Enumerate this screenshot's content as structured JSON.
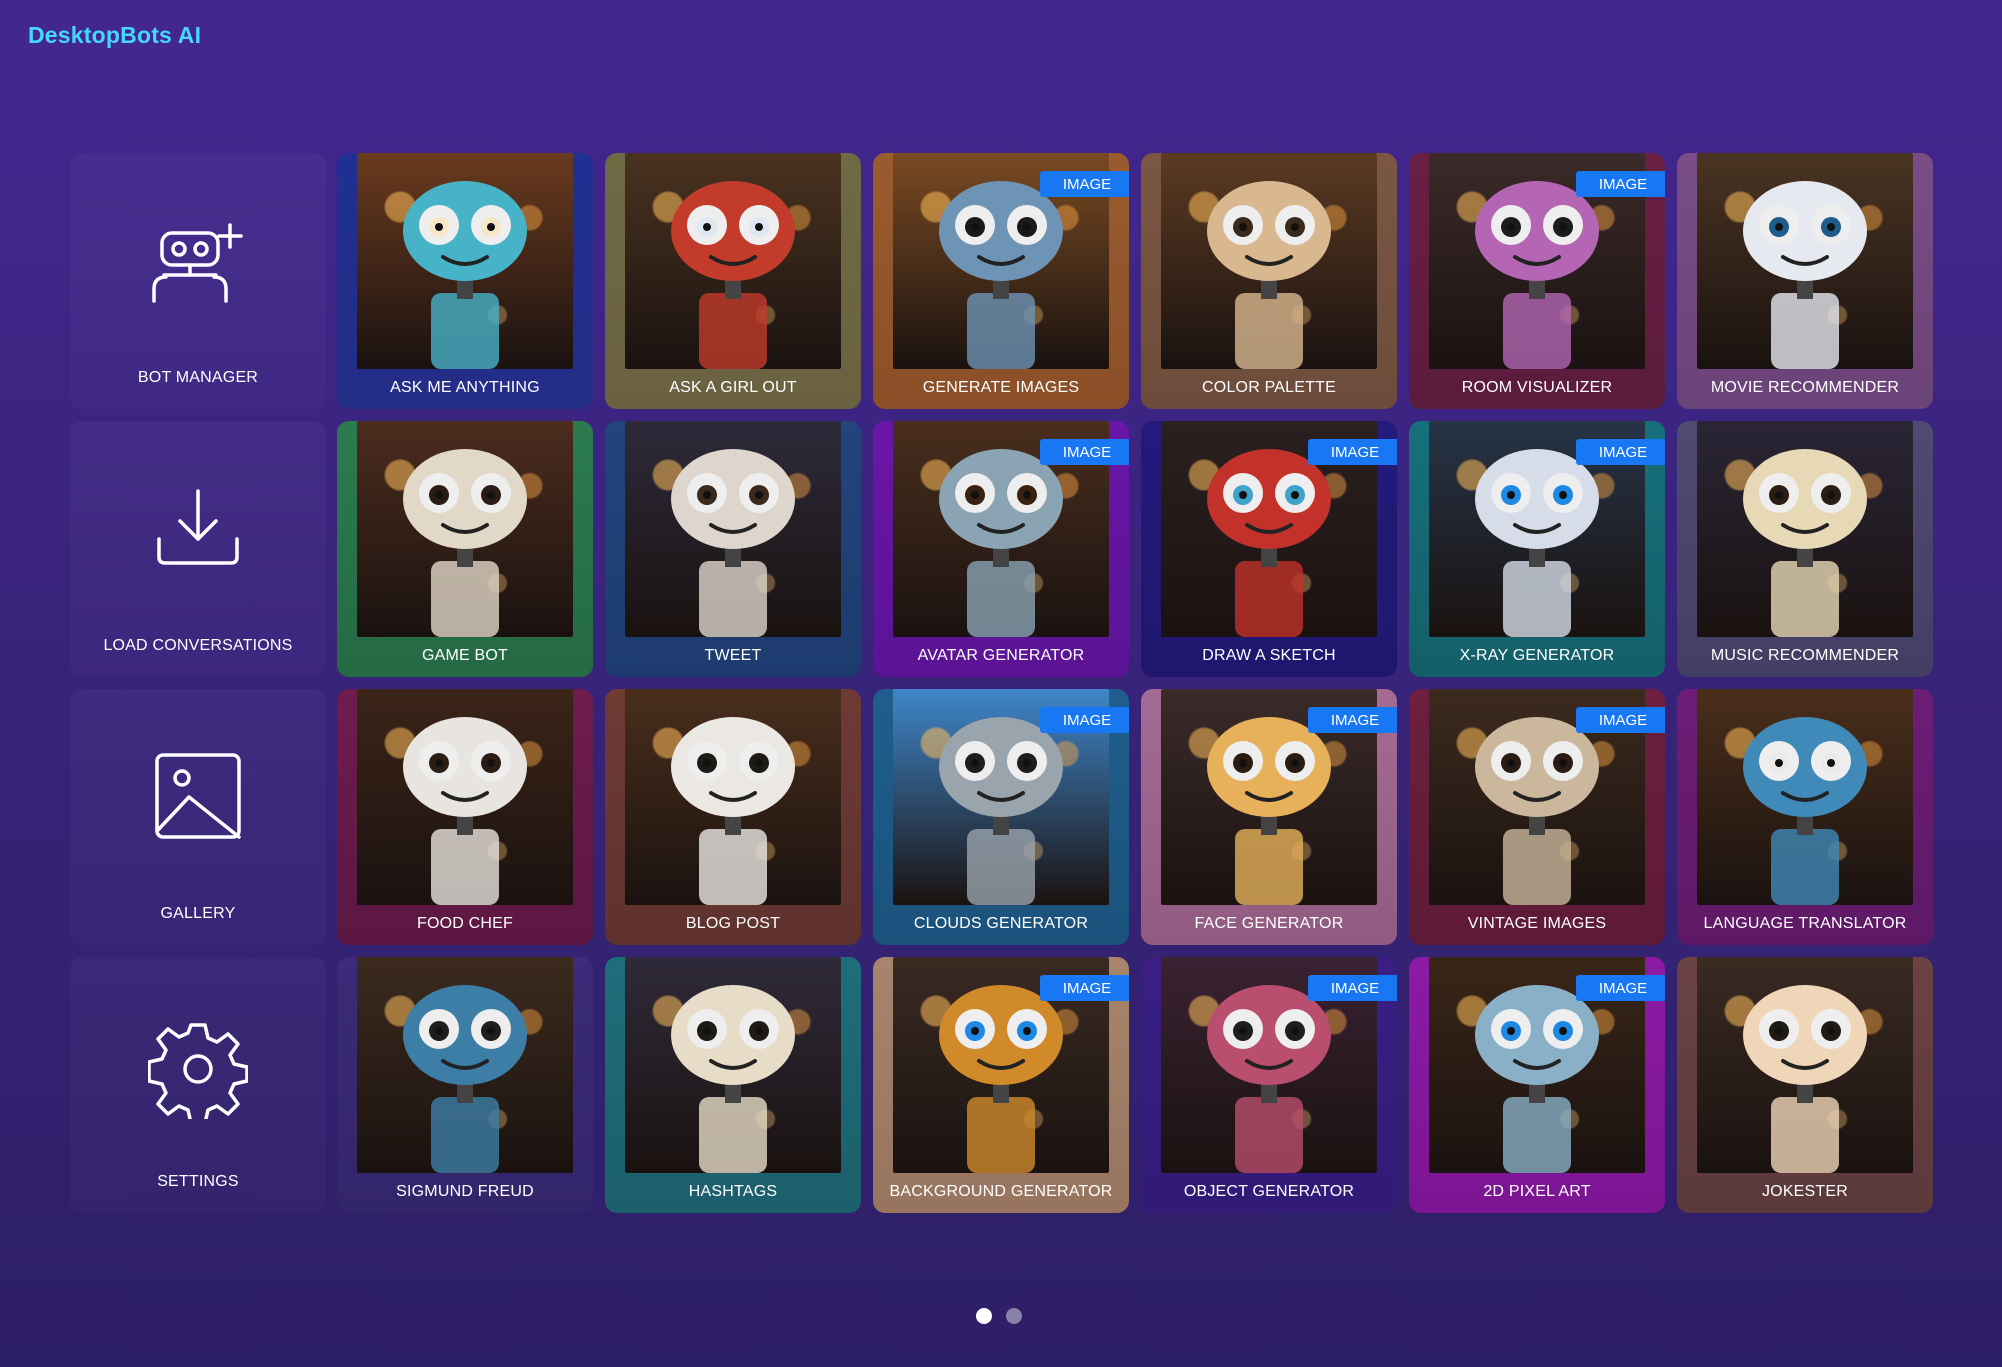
{
  "app": {
    "title": "DesktopBots AI"
  },
  "sidebar": [
    {
      "id": "bot-manager",
      "label": "BOT MANAGER",
      "icon": "robot-add-icon"
    },
    {
      "id": "load-conversations",
      "label": "LOAD CONVERSATIONS",
      "icon": "download-icon"
    },
    {
      "id": "gallery",
      "label": "GALLERY",
      "icon": "image-icon"
    },
    {
      "id": "settings",
      "label": "SETTINGS",
      "icon": "gear-icon"
    }
  ],
  "badge_text": "IMAGE",
  "bots": [
    {
      "label": "ASK ME ANYTHING",
      "image": false,
      "frame": [
        "#1f2f92",
        "#242d86"
      ],
      "face": "#47b3c9",
      "eye": "#f8e6c9",
      "bg": "#6a3a1e"
    },
    {
      "label": "ASK A GIRL OUT",
      "image": false,
      "frame": [
        "#6e6a44",
        "#6a6140"
      ],
      "face": "#c23b2b",
      "eye": "#dfe7f0",
      "bg": "#4a3320"
    },
    {
      "label": "GENERATE IMAGES",
      "image": true,
      "frame": [
        "#9a5b2f",
        "#8b4f27"
      ],
      "face": "#6d94b5",
      "eye": "#1a1a1a",
      "bg": "#7a4a22"
    },
    {
      "label": "COLOR PALETTE",
      "image": false,
      "frame": [
        "#7b5743",
        "#6d4c3b"
      ],
      "face": "#d9b88f",
      "eye": "#3a2a1c",
      "bg": "#5c3a22"
    },
    {
      "label": "ROOM VISUALIZER",
      "image": true,
      "frame": [
        "#6a1f45",
        "#5a1b3c"
      ],
      "face": "#b466b5",
      "eye": "#1c1c1c",
      "bg": "#3b2a2a"
    },
    {
      "label": "MOVIE RECOMMENDER",
      "image": false,
      "frame": [
        "#7a4d86",
        "#6a4378"
      ],
      "face": "#e6e9ef",
      "eye": "#1e5c8c",
      "bg": "#4a3422"
    },
    {
      "label": "GAME BOT",
      "image": false,
      "frame": [
        "#2c7b4f",
        "#246a44"
      ],
      "face": "#e2d8c7",
      "eye": "#2a1c14",
      "bg": "#4c2c1d"
    },
    {
      "label": "TWEET",
      "image": false,
      "frame": [
        "#22457e",
        "#1d3b6e"
      ],
      "face": "#ded6cc",
      "eye": "#3a2a1e",
      "bg": "#2d2a3a"
    },
    {
      "label": "AVATAR GENERATOR",
      "image": true,
      "frame": [
        "#6a16a8",
        "#5b1394"
      ],
      "face": "#8aa4b4",
      "eye": "#3a2212",
      "bg": "#4a2e1e"
    },
    {
      "label": "DRAW A SKETCH",
      "image": true,
      "frame": [
        "#231a7c",
        "#1f176e"
      ],
      "face": "#c2322a",
      "eye": "#3fa2c9",
      "bg": "#2a2020"
    },
    {
      "label": "X-RAY GENERATOR",
      "image": true,
      "frame": [
        "#16707b",
        "#135f69"
      ],
      "face": "#d6dde8",
      "eye": "#1e88e5",
      "bg": "#263447"
    },
    {
      "label": "MUSIC RECOMMENDER",
      "image": false,
      "frame": [
        "#4f4a72",
        "#433f64"
      ],
      "face": "#e8d9b6",
      "eye": "#2a1e14",
      "bg": "#2a2536"
    },
    {
      "label": "FOOD CHEF",
      "image": false,
      "frame": [
        "#6e1c4e",
        "#5c1742"
      ],
      "face": "#e8e4df",
      "eye": "#2c1e14",
      "bg": "#3c2418"
    },
    {
      "label": "BLOG POST",
      "image": false,
      "frame": [
        "#6e3b35",
        "#5f322d"
      ],
      "face": "#ebe8e3",
      "eye": "#1e1a16",
      "bg": "#4a2e1c"
    },
    {
      "label": "CLOUDS GENERATOR",
      "image": true,
      "frame": [
        "#1f5e8d",
        "#1b527c"
      ],
      "face": "#9aa4ad",
      "eye": "#1e1e1e",
      "bg": "#3f86c9"
    },
    {
      "label": "FACE GENERATOR",
      "image": true,
      "frame": [
        "#a46b93",
        "#915b81"
      ],
      "face": "#e6b15a",
      "eye": "#2a1c10",
      "bg": "#3a2b2a"
    },
    {
      "label": "VINTAGE IMAGES",
      "image": true,
      "frame": [
        "#6d1f3f",
        "#5d1a36"
      ],
      "face": "#cbb89c",
      "eye": "#2a1c14",
      "bg": "#3c2a1e"
    },
    {
      "label": "LANGUAGE TRANSLATOR",
      "image": false,
      "frame": [
        "#6d1d76",
        "#5e1966"
      ],
      "face": "#3f8ab8",
      "eye": "#eaeaea",
      "bg": "#4a2e1a"
    },
    {
      "label": "SIGMUND FREUD",
      "image": false,
      "frame": [
        "#3b2b78",
        "#33256a"
      ],
      "face": "#3d7ea6",
      "eye": "#1e1e1e",
      "bg": "#3c2a1e"
    },
    {
      "label": "HASHTAGS",
      "image": false,
      "frame": [
        "#1f6d7b",
        "#1b5f6b"
      ],
      "face": "#e7dcc7",
      "eye": "#1e1a16",
      "bg": "#2f2a3a"
    },
    {
      "label": "BACKGROUND GENERATOR",
      "image": true,
      "frame": [
        "#a9846d",
        "#97745e"
      ],
      "face": "#d08a2a",
      "eye": "#1e88e5",
      "bg": "#3a2a22"
    },
    {
      "label": "OBJECT GENERATOR",
      "image": true,
      "frame": [
        "#3a1e86",
        "#321a76"
      ],
      "face": "#b94e6e",
      "eye": "#1e1e1e",
      "bg": "#3a2232"
    },
    {
      "label": "2D PIXEL ART",
      "image": true,
      "frame": [
        "#8c1aa5",
        "#7b1592"
      ],
      "face": "#8ab0c8",
      "eye": "#1e88e5",
      "bg": "#3a2618"
    },
    {
      "label": "JOKESTER",
      "image": false,
      "frame": [
        "#6b4344",
        "#5b393a"
      ],
      "face": "#f0d6b8",
      "eye": "#1e1a16",
      "bg": "#3a2a22"
    }
  ],
  "pager": {
    "pages": 2,
    "current": 1
  }
}
